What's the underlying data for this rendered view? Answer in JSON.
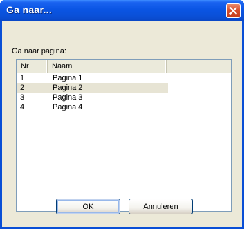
{
  "window": {
    "title": "Ga naar...",
    "close_icon": "close-icon"
  },
  "dialog": {
    "label": "Ga naar pagina:",
    "list": {
      "columns": [
        "Nr",
        "Naam",
        ""
      ],
      "rows": [
        {
          "nr": "1",
          "naam": "Pagina 1",
          "selected": false
        },
        {
          "nr": "2",
          "naam": "Pagina 2",
          "selected": true
        },
        {
          "nr": "3",
          "naam": "Pagina 3",
          "selected": false
        },
        {
          "nr": "4",
          "naam": "Pagina 4",
          "selected": false
        }
      ]
    },
    "buttons": {
      "ok_label": "OK",
      "cancel_label": "Annuleren"
    }
  },
  "colors": {
    "titlebar": "#0a4fd6",
    "client_bg": "#ece9d8",
    "selected_row": "#e7e4d4",
    "close_button": "#d8502d"
  }
}
